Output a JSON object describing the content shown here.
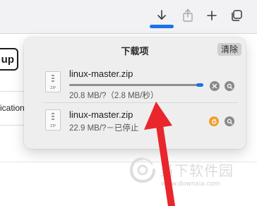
{
  "page": {
    "up_label": "up",
    "left_text": "ication"
  },
  "popover": {
    "title": "下载项",
    "clear_label": "清除"
  },
  "downloads": [
    {
      "filename": "linux-master.zip",
      "status": "20.8 MB/?（2.8 MB/秒）",
      "state": "downloading"
    },
    {
      "filename": "linux-master.zip",
      "status": "22.9 MB/?－已停止",
      "state": "stopped"
    }
  ],
  "watermark": {
    "brand": "当下软件园",
    "url": "www.downxia.com"
  },
  "colors": {
    "accent": "#1a73e8",
    "arrow": "#e8262b",
    "resume": "#f0a030"
  },
  "icons": {
    "toolbar": [
      "download-icon",
      "share-icon",
      "plus-icon",
      "tabs-overview-icon"
    ]
  }
}
